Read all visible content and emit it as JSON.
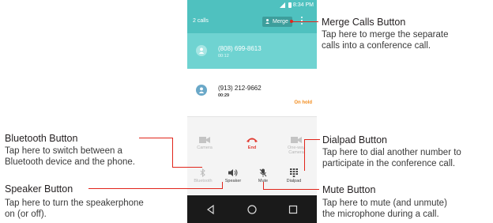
{
  "status_bar": {
    "time": "8:34 PM"
  },
  "header": {
    "calls_count": "2 calls",
    "merge_label": "Merge"
  },
  "calls": [
    {
      "number": "(808) 699-8613",
      "duration": "00:12"
    },
    {
      "number": "(913) 212-9662",
      "duration": "00:29",
      "status": "On hold"
    }
  ],
  "controls": {
    "camera": "Camera",
    "end": "End",
    "one_way_camera_line1": "One-way",
    "one_way_camera_line2": "Camera",
    "bluetooth": "Bluetooth",
    "speaker": "Speaker",
    "mute": "Mute",
    "dialpad": "Dialpad"
  },
  "callouts": {
    "merge": {
      "title": "Merge Calls Button",
      "line1": "Tap here to merge the separate",
      "line2": "calls into a conference call."
    },
    "bluetooth": {
      "title": "Bluetooth Button",
      "line1": "Tap here to switch between a",
      "line2": "Bluetooth device and the phone."
    },
    "speaker": {
      "title": "Speaker Button",
      "line1": "Tap here to turn the speakerphone",
      "line2": "on (or off)."
    },
    "dialpad": {
      "title": "Dialpad Button",
      "line1": "Tap here to dial another number to",
      "line2": "participate in the conference call."
    },
    "mute": {
      "title": "Mute Button",
      "line1": "Tap here to mute (and unmute)",
      "line2": "the microphone during a call."
    }
  },
  "colors": {
    "header_teal": "#4fc1bf",
    "active_call": "#6fd3d1",
    "end_red": "#e13b32",
    "on_hold_orange": "#f28c1e",
    "callout_red": "#e1251b"
  },
  "icons": [
    "signal-icon",
    "battery-icon",
    "person-icon",
    "overflow-menu-icon",
    "video-camera-icon",
    "end-call-icon",
    "bluetooth-icon",
    "speaker-icon",
    "mute-mic-icon",
    "dialpad-icon",
    "back-icon",
    "home-icon",
    "recent-apps-icon"
  ]
}
